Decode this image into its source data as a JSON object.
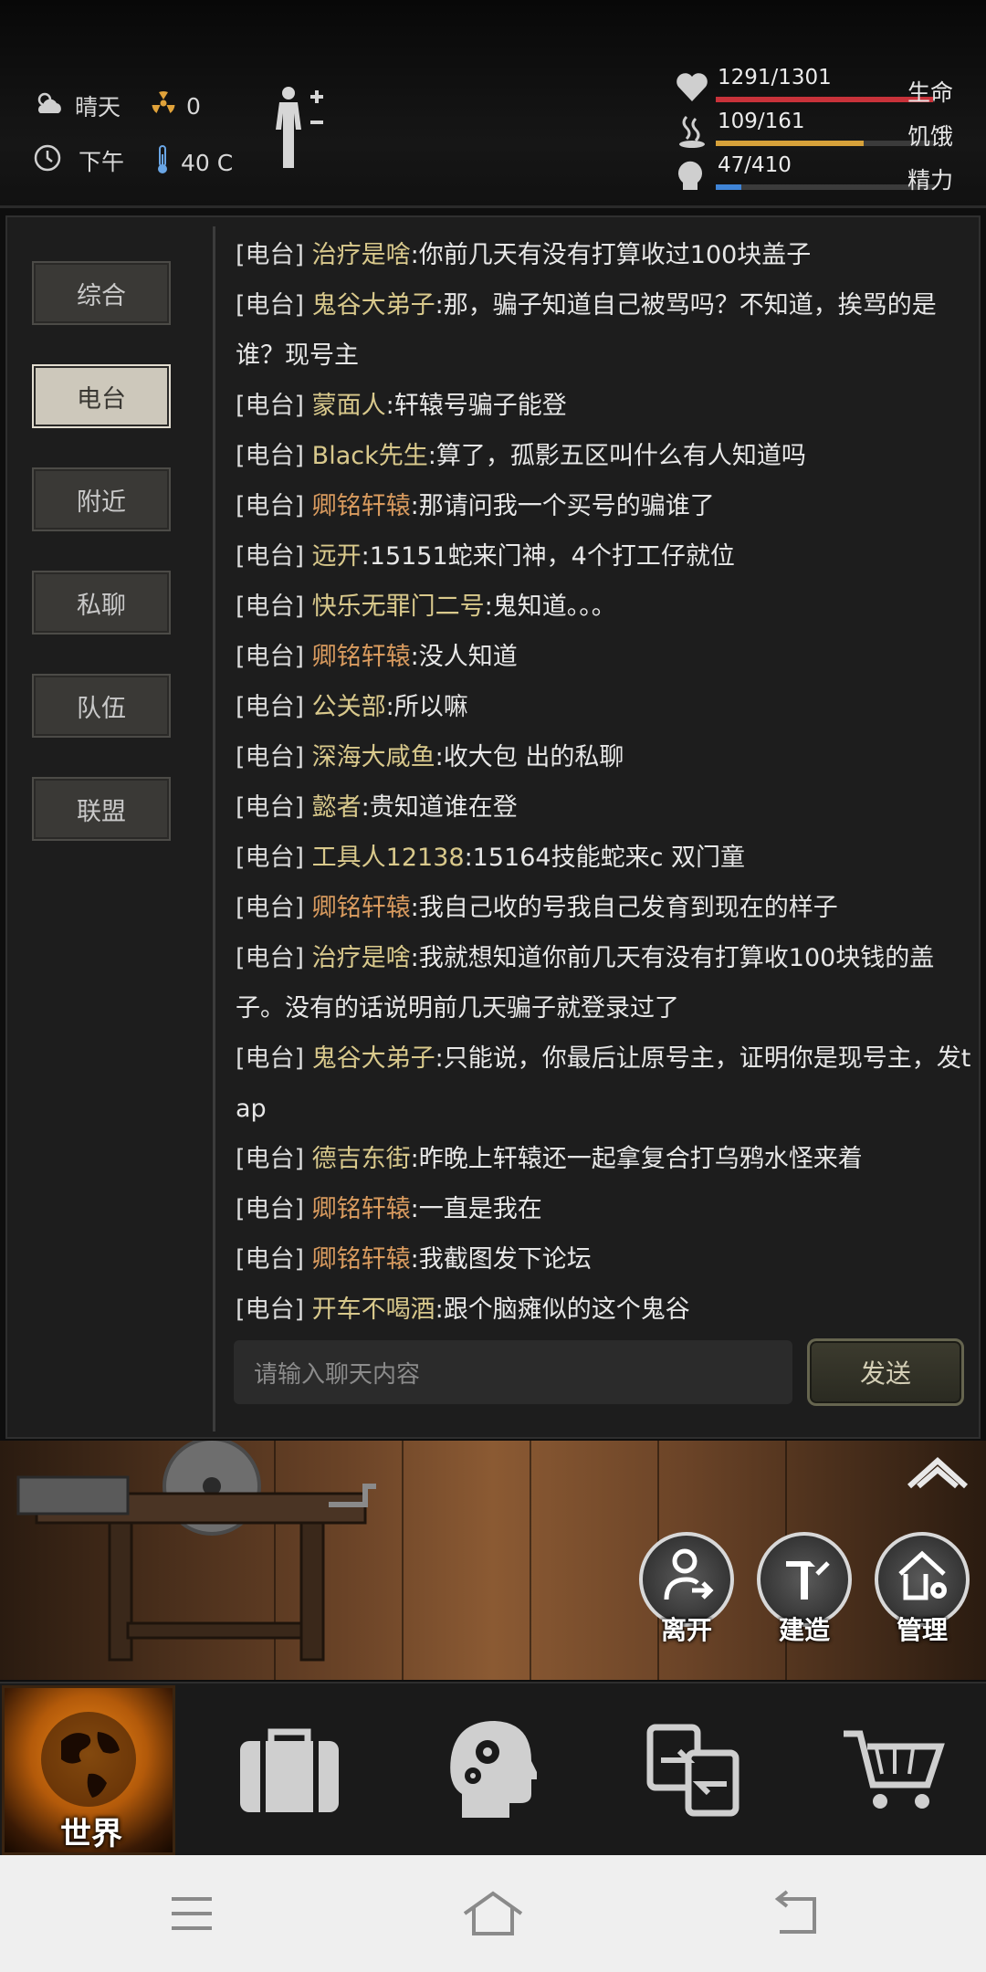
{
  "status": {
    "weather": "晴天",
    "radiation": "0",
    "time_of_day": "下午",
    "temperature": "40 C"
  },
  "meters": [
    {
      "value": "1291/1301",
      "label": "生命",
      "fill_fraction": 0.992,
      "color": "#c8323a"
    },
    {
      "value": "109/161",
      "label": "饥饿",
      "fill_fraction": 0.677,
      "color": "#d6a13a"
    },
    {
      "value": "47/410",
      "label": "精力",
      "fill_fraction": 0.115,
      "color": "#3f84d6"
    }
  ],
  "tabs": [
    {
      "label": "综合",
      "active": false
    },
    {
      "label": "电台",
      "active": true
    },
    {
      "label": "附近",
      "active": false
    },
    {
      "label": "私聊",
      "active": false
    },
    {
      "label": "队伍",
      "active": false
    },
    {
      "label": "联盟",
      "active": false
    }
  ],
  "messages": [
    {
      "channel": "[电台]",
      "name": "治疗是啥",
      "name_color": "yellow",
      "text": ":你前几天有没有打算收过100块盖子"
    },
    {
      "channel": "[电台]",
      "name": "鬼谷大弟子",
      "name_color": "yellow",
      "text": ":那，骗子知道自己被骂吗？不知道，挨骂的是谁？现号主"
    },
    {
      "channel": "[电台]",
      "name": "蒙面人",
      "name_color": "yellow",
      "text": ":轩辕号骗子能登"
    },
    {
      "channel": "[电台]",
      "name": "Black先生",
      "name_color": "yellow",
      "text": ":算了，孤影五区叫什么有人知道吗"
    },
    {
      "channel": "[电台]",
      "name": "卿铭轩辕",
      "name_color": "orange",
      "text": ":那请问我一个买号的骗谁了"
    },
    {
      "channel": "[电台]",
      "name": "远开",
      "name_color": "yellow",
      "text": ":15151蛇来门神，4个打工仔就位"
    },
    {
      "channel": "[电台]",
      "name": "快乐无罪门二号",
      "name_color": "yellow",
      "text": ":鬼知道。。。"
    },
    {
      "channel": "[电台]",
      "name": "卿铭轩辕",
      "name_color": "orange",
      "text": ":没人知道"
    },
    {
      "channel": "[电台]",
      "name": "公关部",
      "name_color": "yellow",
      "text": ":所以嘛"
    },
    {
      "channel": "[电台]",
      "name": "深海大咸鱼",
      "name_color": "yellow",
      "text": ":收大包 出的私聊"
    },
    {
      "channel": "[电台]",
      "name": "懿者",
      "name_color": "yellow",
      "text": ":贵知道谁在登"
    },
    {
      "channel": "[电台]",
      "name": "工具人12138",
      "name_color": "yellow",
      "text": ":15164技能蛇来c 双门童"
    },
    {
      "channel": "[电台]",
      "name": "卿铭轩辕",
      "name_color": "orange",
      "text": ":我自己收的号我自己发育到现在的样子"
    },
    {
      "channel": "[电台]",
      "name": "治疗是啥",
      "name_color": "yellow",
      "text": ":我就想知道你前几天有没有打算收100块钱的盖子。没有的话说明前几天骗子就登录过了"
    },
    {
      "channel": "[电台]",
      "name": "鬼谷大弟子",
      "name_color": "yellow",
      "text": ":只能说，你最后让原号主，证明你是现号主，发tap"
    },
    {
      "channel": "[电台]",
      "name": "德吉东街",
      "name_color": "yellow",
      "text": ":昨晚上轩辕还一起拿复合打乌鸦水怪来着"
    },
    {
      "channel": "[电台]",
      "name": "卿铭轩辕",
      "name_color": "orange",
      "text": ":一直是我在"
    },
    {
      "channel": "[电台]",
      "name": "卿铭轩辕",
      "name_color": "orange",
      "text": ":我截图发下论坛"
    },
    {
      "channel": "[电台]",
      "name": "开车不喝酒",
      "name_color": "yellow",
      "text": ":跟个脑瘫似的这个鬼谷"
    }
  ],
  "chat_input": {
    "placeholder": "请输入聊天内容"
  },
  "send_label": "发送",
  "actions": [
    {
      "label": "离开"
    },
    {
      "label": "建造"
    },
    {
      "label": "管理"
    }
  ],
  "bottom_nav": {
    "world_label": "世界"
  }
}
